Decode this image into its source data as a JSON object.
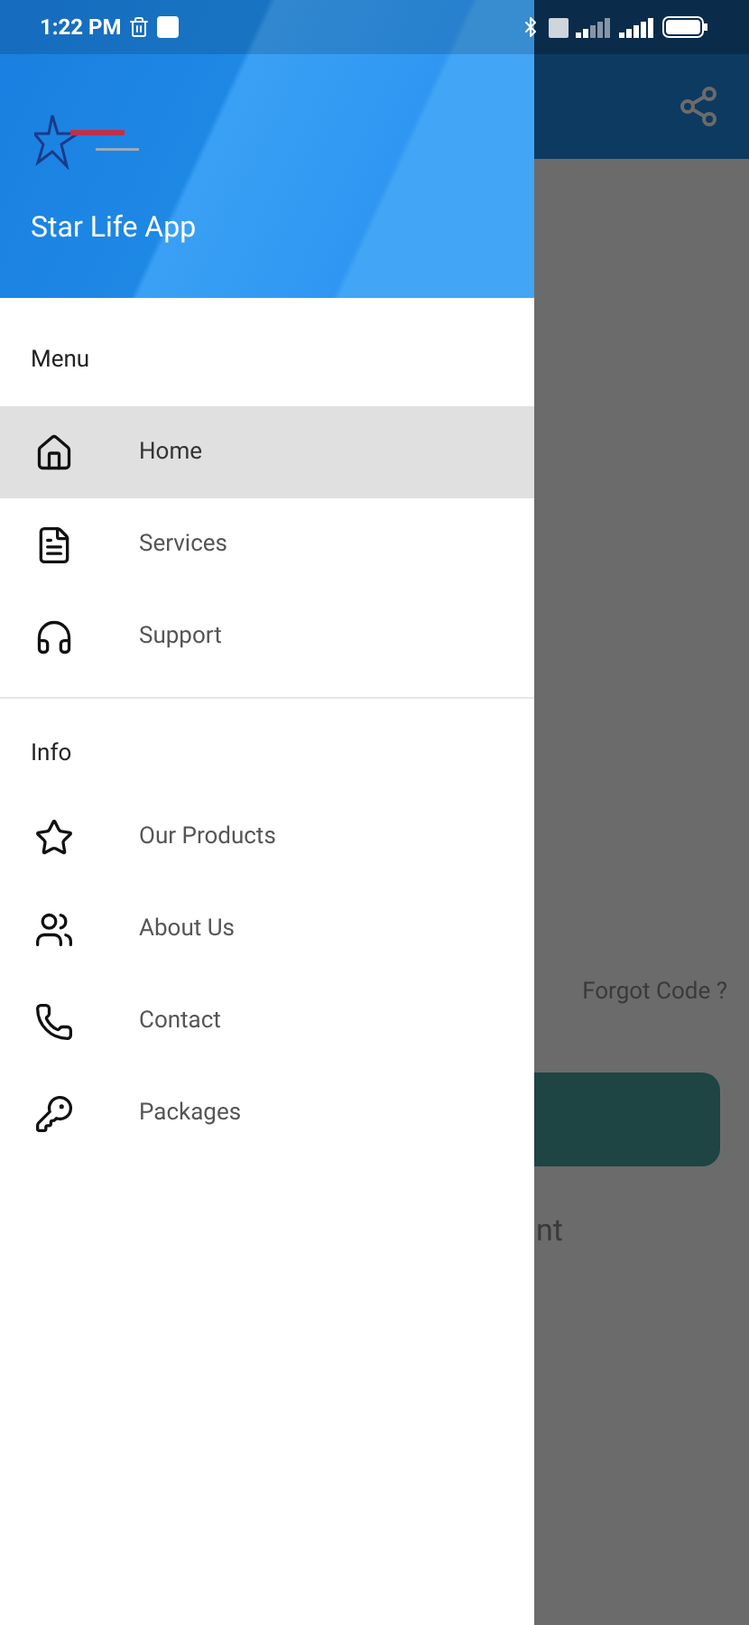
{
  "status_bar": {
    "time": "1:22 PM"
  },
  "drawer": {
    "app_name": "Star Life App",
    "sections": [
      {
        "title": "Menu",
        "items": [
          {
            "label": "Home",
            "kind": "home",
            "selected": true
          },
          {
            "label": "Services",
            "kind": "document",
            "selected": false
          },
          {
            "label": "Support",
            "kind": "headset",
            "selected": false
          }
        ]
      },
      {
        "title": "Info",
        "items": [
          {
            "label": "Our Products",
            "kind": "star",
            "selected": false
          },
          {
            "label": "About Us",
            "kind": "people",
            "selected": false
          },
          {
            "label": "Contact",
            "kind": "phone",
            "selected": false
          },
          {
            "label": "Packages",
            "kind": "key",
            "selected": false
          }
        ]
      }
    ]
  },
  "background": {
    "forgot_link": "Forgot Code ?",
    "partial_text": "nt"
  }
}
